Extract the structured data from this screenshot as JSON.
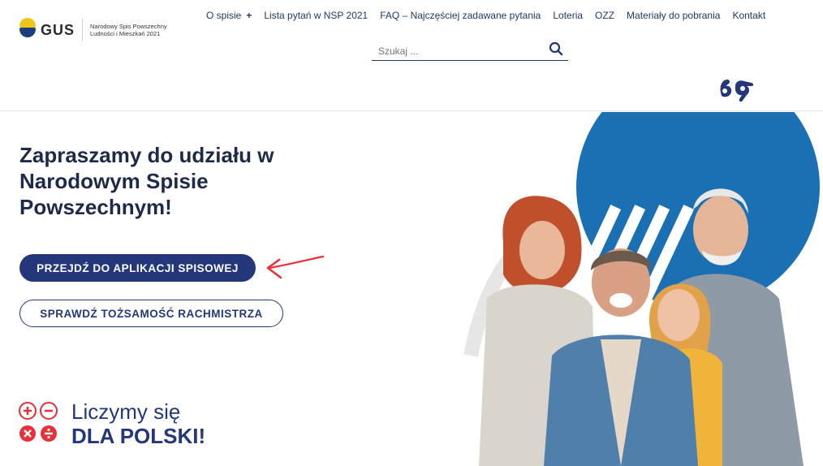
{
  "header": {
    "logo": {
      "name": "GUS",
      "subtitle_line1": "Narodowy Spis Powszechny",
      "subtitle_line2": "Ludności i Mieszkań 2021"
    },
    "nav": [
      {
        "label": "O spisie",
        "suffix": "+"
      },
      {
        "label": "Lista pytań w NSP 2021"
      },
      {
        "label": "FAQ – Najczęściej zadawane pytania"
      },
      {
        "label": "Loteria"
      },
      {
        "label": "OZZ"
      },
      {
        "label": "Materiały do pobrania"
      },
      {
        "label": "Kontakt"
      }
    ],
    "search": {
      "placeholder": "Szukaj ...",
      "icon": "search-icon"
    },
    "accessibility_icon": "sign-language-icon"
  },
  "hero": {
    "title": "Zapraszamy do udziału w Narodowym Spisie Powszechnym!",
    "primary_button": "PRZEJDŹ DO APLIKACJI SPISOWEJ",
    "secondary_button": "SPRAWDŹ TOŻSAMOŚĆ RACHMISTRZA",
    "campaign": {
      "line1": "Liczymy się",
      "line2": "DLA POLSKI!"
    }
  },
  "colors": {
    "navy": "#24377a",
    "accent_red": "#e8303a",
    "blue_circle": "#1b6fb3",
    "logo_yellow": "#f0c419"
  }
}
